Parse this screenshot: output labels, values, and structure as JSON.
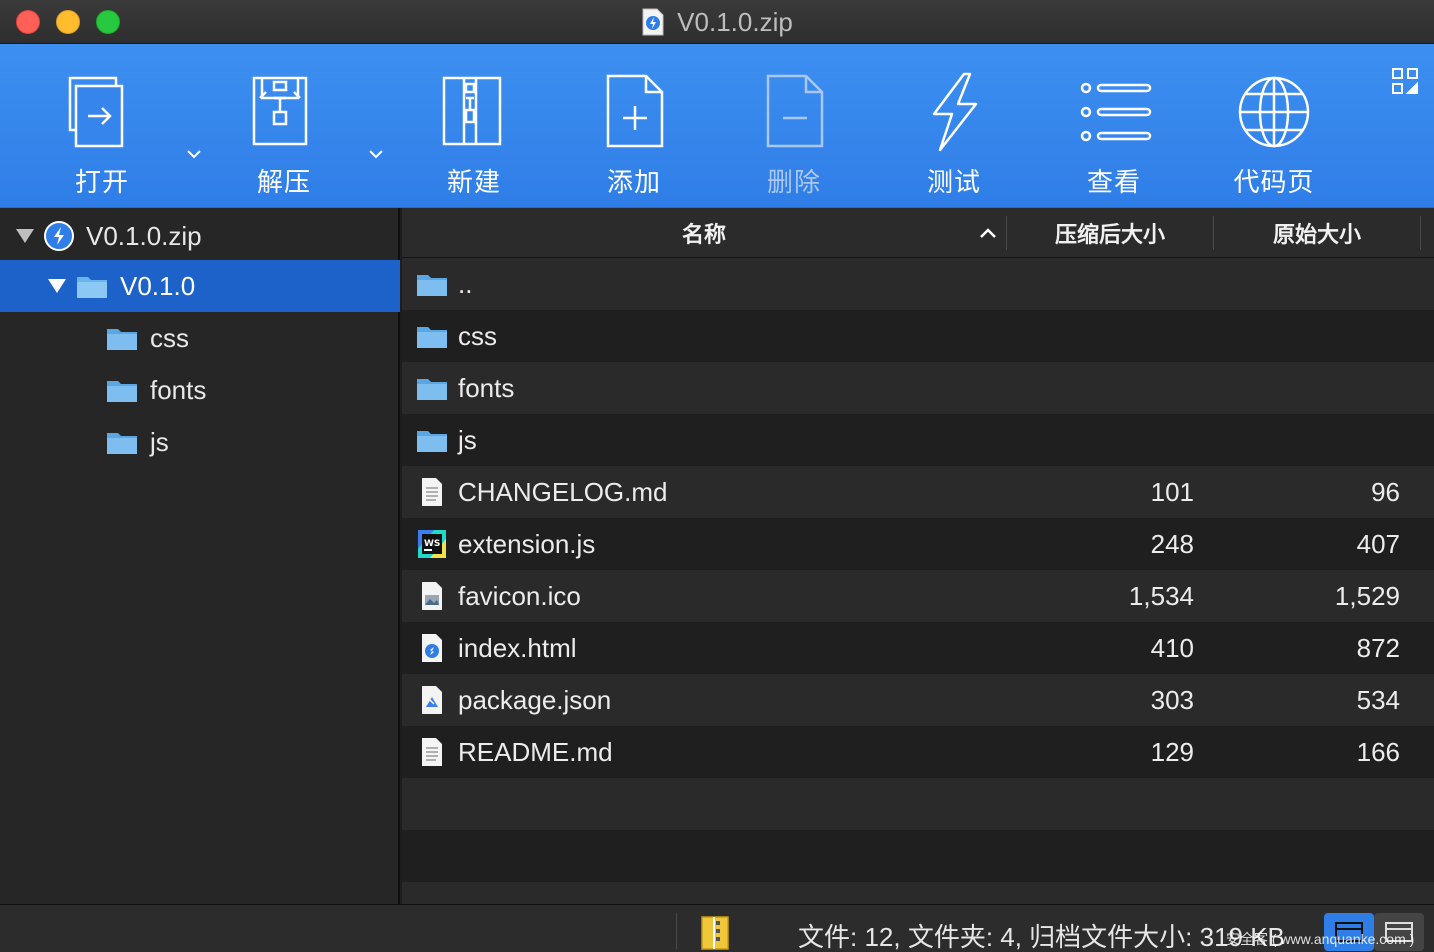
{
  "window": {
    "title": "V0.1.0.zip"
  },
  "toolbar": {
    "items": [
      {
        "label": "打开",
        "icon": "open-icon",
        "enabled": true
      },
      {
        "label": "解压",
        "icon": "extract-icon",
        "enabled": true
      },
      {
        "label": "新建",
        "icon": "new-archive-icon",
        "enabled": true
      },
      {
        "label": "添加",
        "icon": "add-file-icon",
        "enabled": true
      },
      {
        "label": "删除",
        "icon": "delete-file-icon",
        "enabled": false
      },
      {
        "label": "测试",
        "icon": "test-lightning-icon",
        "enabled": true
      },
      {
        "label": "查看",
        "icon": "view-list-icon",
        "enabled": true
      },
      {
        "label": "代码页",
        "icon": "codepage-globe-icon",
        "enabled": true
      }
    ],
    "accent": "#3d8ff0"
  },
  "sidebar": {
    "items": [
      {
        "label": "V0.1.0.zip",
        "level": 0,
        "expanded": true,
        "selected": false,
        "type": "archive"
      },
      {
        "label": "V0.1.0",
        "level": 1,
        "expanded": true,
        "selected": true,
        "type": "folder"
      },
      {
        "label": "css",
        "level": 2,
        "type": "folder"
      },
      {
        "label": "fonts",
        "level": 2,
        "type": "folder"
      },
      {
        "label": "js",
        "level": 2,
        "type": "folder"
      }
    ],
    "selection_color": "#1d62c8"
  },
  "list": {
    "columns": {
      "name": "名称",
      "compressed": "压缩后大小",
      "original": "原始大小"
    },
    "rows": [
      {
        "name": "..",
        "icon": "folder-icon",
        "compressed": "",
        "original": ""
      },
      {
        "name": "css",
        "icon": "folder-icon",
        "compressed": "",
        "original": ""
      },
      {
        "name": "fonts",
        "icon": "folder-icon",
        "compressed": "",
        "original": ""
      },
      {
        "name": "js",
        "icon": "folder-icon",
        "compressed": "",
        "original": ""
      },
      {
        "name": "CHANGELOG.md",
        "icon": "text-file-icon",
        "compressed": "101",
        "original": "96"
      },
      {
        "name": "extension.js",
        "icon": "webstorm-file-icon",
        "compressed": "248",
        "original": "407"
      },
      {
        "name": "favicon.ico",
        "icon": "image-file-icon",
        "compressed": "1,534",
        "original": "1,529"
      },
      {
        "name": "index.html",
        "icon": "html-file-icon",
        "compressed": "410",
        "original": "872"
      },
      {
        "name": "package.json",
        "icon": "json-file-icon",
        "compressed": "303",
        "original": "534"
      },
      {
        "name": "README.md",
        "icon": "text-file-icon",
        "compressed": "129",
        "original": "166"
      }
    ]
  },
  "status": {
    "summary": "文件: 12, 文件夹: 4, 归档文件大小: 319 KB",
    "watermark": "安全客 ( www.anquanke.com )"
  }
}
